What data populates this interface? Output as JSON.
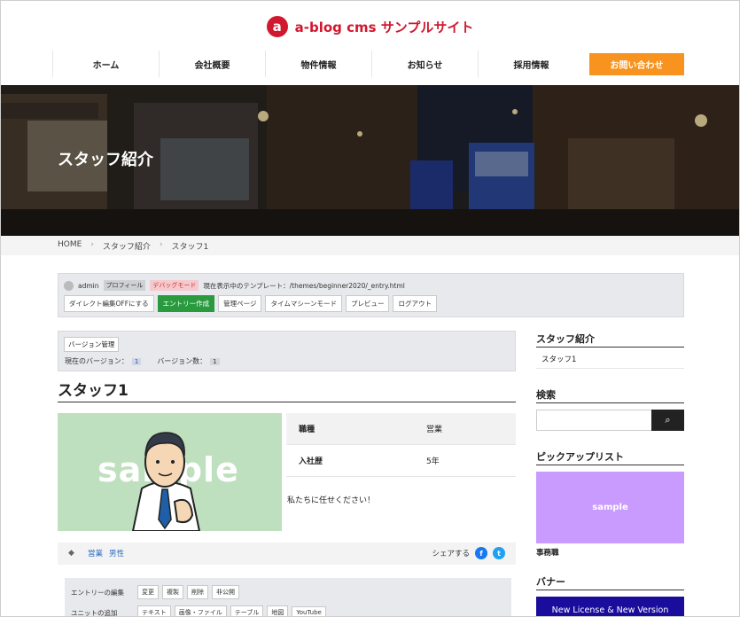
{
  "site": {
    "logo_mark": "a",
    "title": "a-blog cms サンプルサイト"
  },
  "nav": {
    "items": [
      "ホーム",
      "会社概要",
      "物件情報",
      "お知らせ",
      "採用情報"
    ],
    "cta": "お問い合わせ"
  },
  "hero": {
    "title": "スタッフ紹介"
  },
  "breadcrumb": {
    "items": [
      "HOME",
      "スタッフ紹介",
      "スタッフ1"
    ],
    "separator": "›"
  },
  "admin": {
    "user": "admin",
    "profile": "プロフィール",
    "debug": "デバッグモード",
    "template_label": "現在表示中のテンプレート：/themes/beginner2020/_entry.html",
    "buttons": [
      "ダイレクト編集OFFにする",
      "エントリー作成",
      "管理ページ",
      "タイムマシーンモード",
      "プレビュー",
      "ログアウト"
    ]
  },
  "version": {
    "button": "バージョン管理",
    "current_label": "現在のバージョン：",
    "current": "1",
    "count_label": "バージョン数：",
    "count": "1"
  },
  "entry": {
    "title": "スタッフ1",
    "image_text": "sample",
    "table": [
      {
        "k": "職種",
        "v": "営業"
      },
      {
        "k": "入社歴",
        "v": "5年"
      }
    ],
    "body": "私たちに任せください！",
    "tags": [
      "営業",
      "男性"
    ],
    "share_label": "シェアする"
  },
  "edit": {
    "entry_label": "エントリーの編集",
    "entry_buttons": [
      "変更",
      "複製",
      "削除",
      "非公開"
    ],
    "unit_label": "ユニットの追加",
    "unit_buttons": [
      "テキスト",
      "画像・ファイル",
      "テーブル",
      "地図",
      "YouTube"
    ]
  },
  "sidebar": {
    "staff_heading": "スタッフ紹介",
    "staff_link": "スタッフ1",
    "search_heading": "検索",
    "search_placeholder": "",
    "pickup_heading": "ピックアップリスト",
    "pickup_image_text": "sample",
    "pickup_caption": "事務職",
    "banner_heading": "バナー",
    "banner_text": "New License & New Version"
  },
  "colors": {
    "brand": "#d0182f",
    "cta": "#f7931e",
    "green": "#2a9a3f",
    "pickup": "#c99bff",
    "banner": "#1a0d9c",
    "facebook": "#1877f2",
    "twitter": "#1da1f2"
  }
}
